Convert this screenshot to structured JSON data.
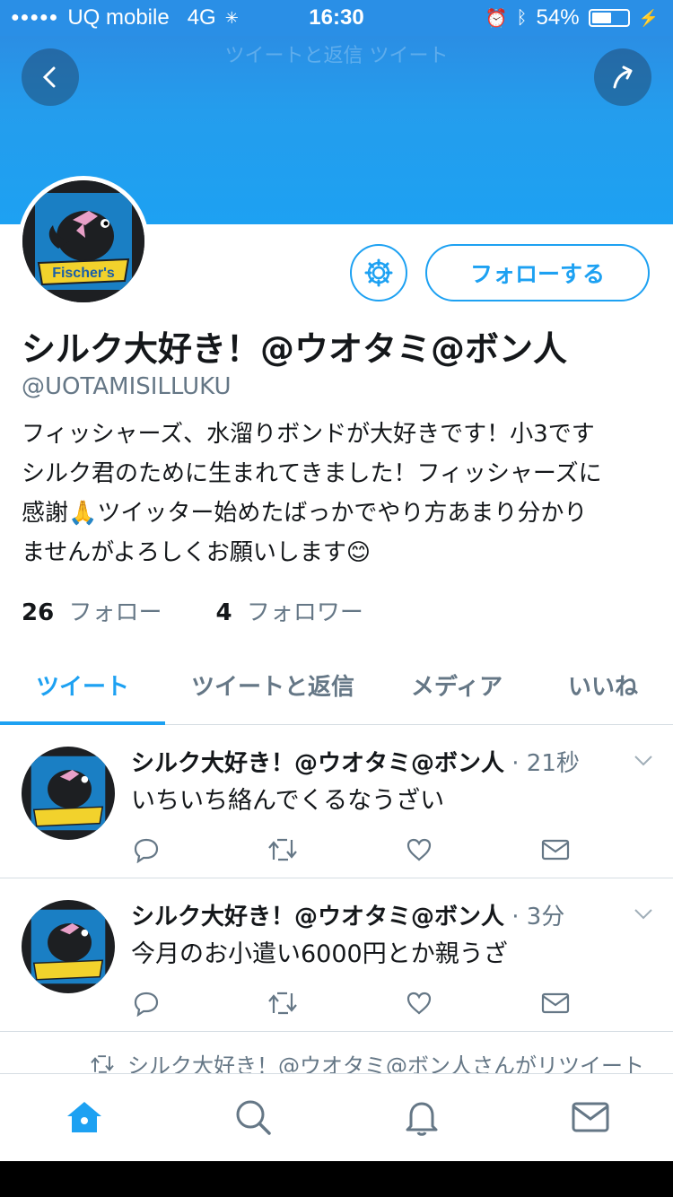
{
  "status_bar": {
    "carrier": "UQ mobile",
    "network": "4G",
    "time": "16:30",
    "battery": "54%",
    "battery_level": 0.54
  },
  "header": {
    "faded_text": "ツイートと返信 ツイート"
  },
  "profile": {
    "follow_button": "フォローする",
    "display_name": "シルク大好き！@ウオタミ@ボン人",
    "handle": "@UOTAMISILLUKU",
    "bio_lines": [
      "フィッシャーズ、水溜りボンドが大好きです！小3です",
      "シルク君のために生まれてきました！フィッシャーズに",
      "感謝🙏ツイッター始めたばっかでやり方あまり分かり",
      "ませんがよろしくお願いします😊"
    ],
    "following_count": "26",
    "following_label": "フォロー",
    "followers_count": "4",
    "followers_label": "フォロワー",
    "avatar_badge": "Fischer's"
  },
  "tabs": [
    {
      "label": "ツイート",
      "active": true
    },
    {
      "label": "ツイートと返信",
      "active": false
    },
    {
      "label": "メディア",
      "active": false
    },
    {
      "label": "いいね",
      "active": false
    }
  ],
  "tweets": [
    {
      "name": "シルク大好き！@ウオタミ@ボン人",
      "time": " · 21秒",
      "text": "いちいち絡んでくるなうざい"
    },
    {
      "name": "シルク大好き！@ウオタミ@ボン人",
      "time": " · 3分",
      "text": "今月のお小遣い6000円とか親うざ"
    }
  ],
  "retweet_note": "シルク大好き！@ウオタミ@ボン人さんがリツイート",
  "colors": {
    "accent": "#1da1f2",
    "banner": "#2a8fe6",
    "muted_text": "#657786"
  },
  "icons": {
    "tweet_actions": [
      "reply-icon",
      "retweet-icon",
      "like-icon",
      "dm-icon"
    ],
    "bottom_nav": [
      "home-icon",
      "search-icon",
      "notifications-icon",
      "messages-icon"
    ]
  }
}
